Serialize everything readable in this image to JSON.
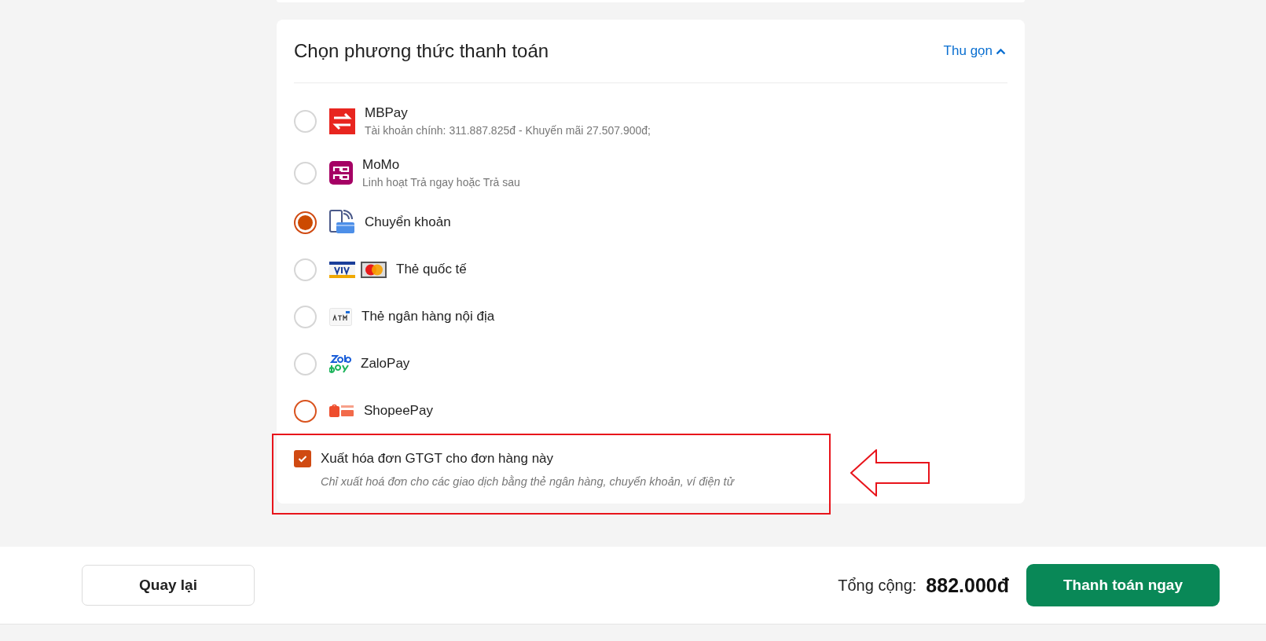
{
  "payment": {
    "title": "Chọn phương thức thanh toán",
    "collapse_link": "Thu gọn",
    "methods": [
      {
        "kind": "mbpay",
        "name": "MBPay",
        "description": "Tài khoản chính: 311.887.825đ - Khuyến mãi 27.507.900đ;",
        "selected": false,
        "color": "#d6d6d6"
      },
      {
        "kind": "momo",
        "name": "MoMo",
        "description": "Linh hoạt Trả ngay hoặc Trả sau",
        "selected": false,
        "color": "#d6d6d6"
      },
      {
        "kind": "transfer",
        "name": "Chuyển khoản",
        "selected": true,
        "color": "#d04a12"
      },
      {
        "kind": "cards",
        "name": "Thẻ quốc tế",
        "selected": false,
        "color": "#d6d6d6"
      },
      {
        "kind": "atm",
        "name": "Thẻ ngân hàng nội địa",
        "selected": false,
        "color": "#d6d6d6"
      },
      {
        "kind": "zalopay",
        "name": "ZaloPay",
        "selected": false,
        "color": "#d6d6d6"
      },
      {
        "kind": "shopeepay",
        "name": "ShopeePay",
        "selected": false,
        "color": "#d9531e"
      }
    ],
    "invoice": {
      "label": "Xuất hóa đơn GTGT cho đơn hàng này",
      "note": "Chỉ xuất hoá đơn cho các giao dịch bằng thẻ ngân hàng, chuyển khoản, ví điện tử",
      "checked": true
    }
  },
  "footer": {
    "back_button": "Quay lại",
    "total_label": "Tổng cộng:",
    "total_amount": "882.000đ",
    "pay_button": "Thanh toán ngay"
  }
}
